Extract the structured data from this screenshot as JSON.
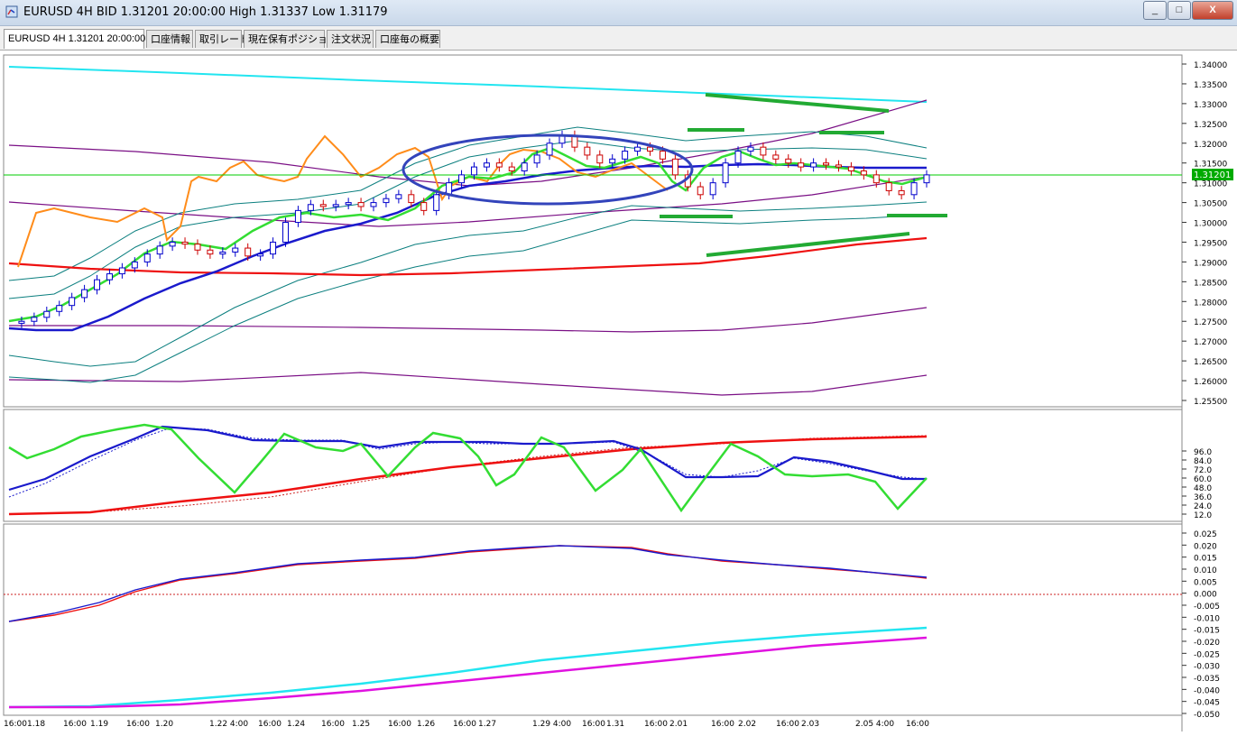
{
  "window": {
    "title": "EURUSD 4H BID 1.31201 20:00:00 High 1.31337 Low 1.31179",
    "buttons": {
      "minimize": "_",
      "maximize": "□",
      "close": "X"
    }
  },
  "tabs": [
    {
      "label": "EURUSD 4H 1.31201 20:00:00",
      "active": true
    },
    {
      "label": "口座情報"
    },
    {
      "label": "取引レート"
    },
    {
      "label": "現在保有ポジション"
    },
    {
      "label": "注文状況"
    },
    {
      "label": "口座毎の概要"
    }
  ],
  "colors": {
    "candle_up": "#0000cc",
    "candle_down": "#cc0000",
    "price_line": "#00cc00",
    "fast_ma": "#33dd33",
    "slow_ma": "#1a1acc",
    "long_ma": "#ee1111",
    "orange_line": "#ff8c1a",
    "cyan": "#22e5f0",
    "purple": "#7a0f85",
    "bollinger": "#0b7f7f",
    "ellipse": "#3344bb",
    "magenta": "#e012e0",
    "annotation_green": "#22aa33"
  },
  "price_pane": {
    "current_price": "1.31201",
    "y_labels": [
      "1.34000",
      "1.33500",
      "1.33000",
      "1.32500",
      "1.32000",
      "1.31500",
      "1.31000",
      "1.30500",
      "1.30000",
      "1.29500",
      "1.29000",
      "1.28500",
      "1.28000",
      "1.27500",
      "1.27000",
      "1.26500",
      "1.26000",
      "1.25500"
    ]
  },
  "stoch_pane": {
    "y_labels": [
      "96.0",
      "84.0",
      "72.0",
      "60.0",
      "48.0",
      "36.0",
      "24.0",
      "12.0"
    ]
  },
  "macd_pane": {
    "y_labels": [
      "0.025",
      "0.020",
      "0.015",
      "0.010",
      "0.005",
      "0.000",
      "-0.005",
      "-0.010",
      "-0.015",
      "-0.020",
      "-0.025",
      "-0.030",
      "-0.035",
      "-0.040",
      "-0.045",
      "-0.050"
    ]
  },
  "x_labels": [
    "16:00",
    "1.18",
    "16:00",
    "1.19",
    "16:00",
    "1.20",
    "1.22 4:00",
    "16:00",
    "1.24",
    "16:00",
    "1.25",
    "16:00",
    "1.26",
    "16:00",
    "1.27",
    "1.29 4:00",
    "16:00",
    "1.31",
    "16:00",
    "2.01",
    "16:00",
    "2.02",
    "16:00",
    "2.03",
    "2.05 4:00",
    "16:00"
  ],
  "chart_data": {
    "type": "line",
    "series": [
      {
        "name": "",
        "type": "candlestick",
        "open_close_sample": [
          [
            1.2745,
            1.2755
          ],
          [
            1.2755,
            1.279
          ],
          [
            1.283,
            1.289
          ],
          [
            1.289,
            1.294
          ],
          [
            1.294,
            1.2915
          ],
          [
            1.2915,
            1.2935
          ],
          [
            1.292,
            1.305
          ],
          [
            1.302,
            1.304
          ],
          [
            1.304,
            1.3055
          ],
          [
            1.3,
            1.309
          ],
          [
            1.31,
            1.314
          ],
          [
            1.315,
            1.313
          ],
          [
            1.316,
            1.322
          ],
          [
            1.319,
            1.315
          ],
          [
            1.312,
            1.316
          ],
          [
            1.32,
            1.318
          ],
          [
            1.315,
            1.309
          ],
          [
            1.308,
            1.318
          ],
          [
            1.319,
            1.315
          ],
          [
            1.315,
            1.314
          ],
          [
            1.315,
            1.31
          ],
          [
            1.308,
            1.305
          ],
          [
            1.308,
            1.312
          ]
        ]
      }
    ],
    "ylim": [
      1.255,
      1.34
    ]
  }
}
